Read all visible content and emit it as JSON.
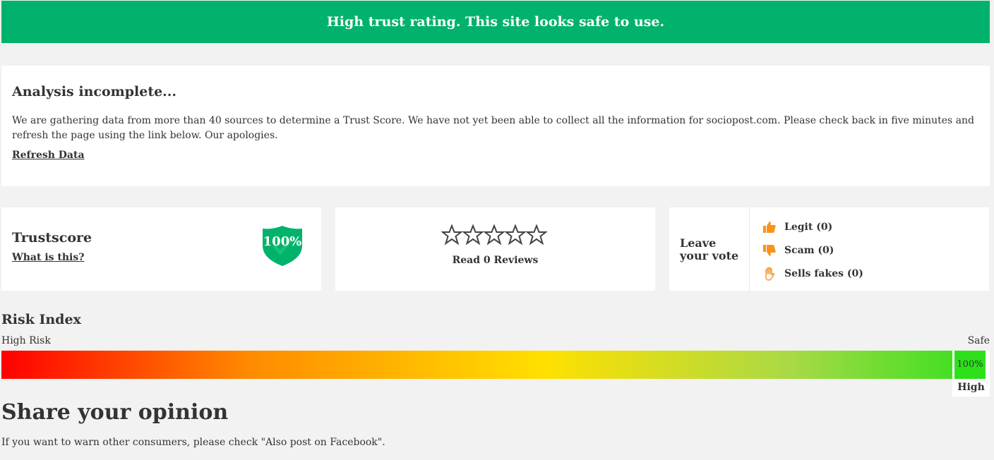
{
  "banner": {
    "text": "High trust rating. This site looks safe to use."
  },
  "analysis": {
    "title": "Analysis incomplete...",
    "body": "We are gathering data from more than 40 sources to determine a Trust Score. We have not yet been able to collect all the information for sociopost.com. Please check back in five minutes and refresh the page using the link below. Our apologies.",
    "refresh_link": "Refresh Data"
  },
  "trustscore": {
    "label": "Trustscore",
    "help_link": "What is this?",
    "value": "100%",
    "shield_color": "#00b26b"
  },
  "reviews": {
    "stars_filled": 0,
    "stars_total": 5,
    "read_link": "Read 0 Reviews"
  },
  "vote": {
    "label": "Leave your vote",
    "options": [
      {
        "label": "Legit (0)",
        "icon": "thumbs-up-icon"
      },
      {
        "label": "Scam (0)",
        "icon": "thumbs-down-icon"
      },
      {
        "label": "Sells fakes (0)",
        "icon": "hand-stop-icon"
      }
    ],
    "icon_color": "#f7941d"
  },
  "risk": {
    "title": "Risk Index",
    "low_label": "High Risk",
    "high_label": "Safe",
    "value": "100%",
    "level": "High"
  },
  "share": {
    "title": "Share your opinion",
    "text": "If you want to warn other consumers, please check \"Also post on Facebook\"."
  }
}
